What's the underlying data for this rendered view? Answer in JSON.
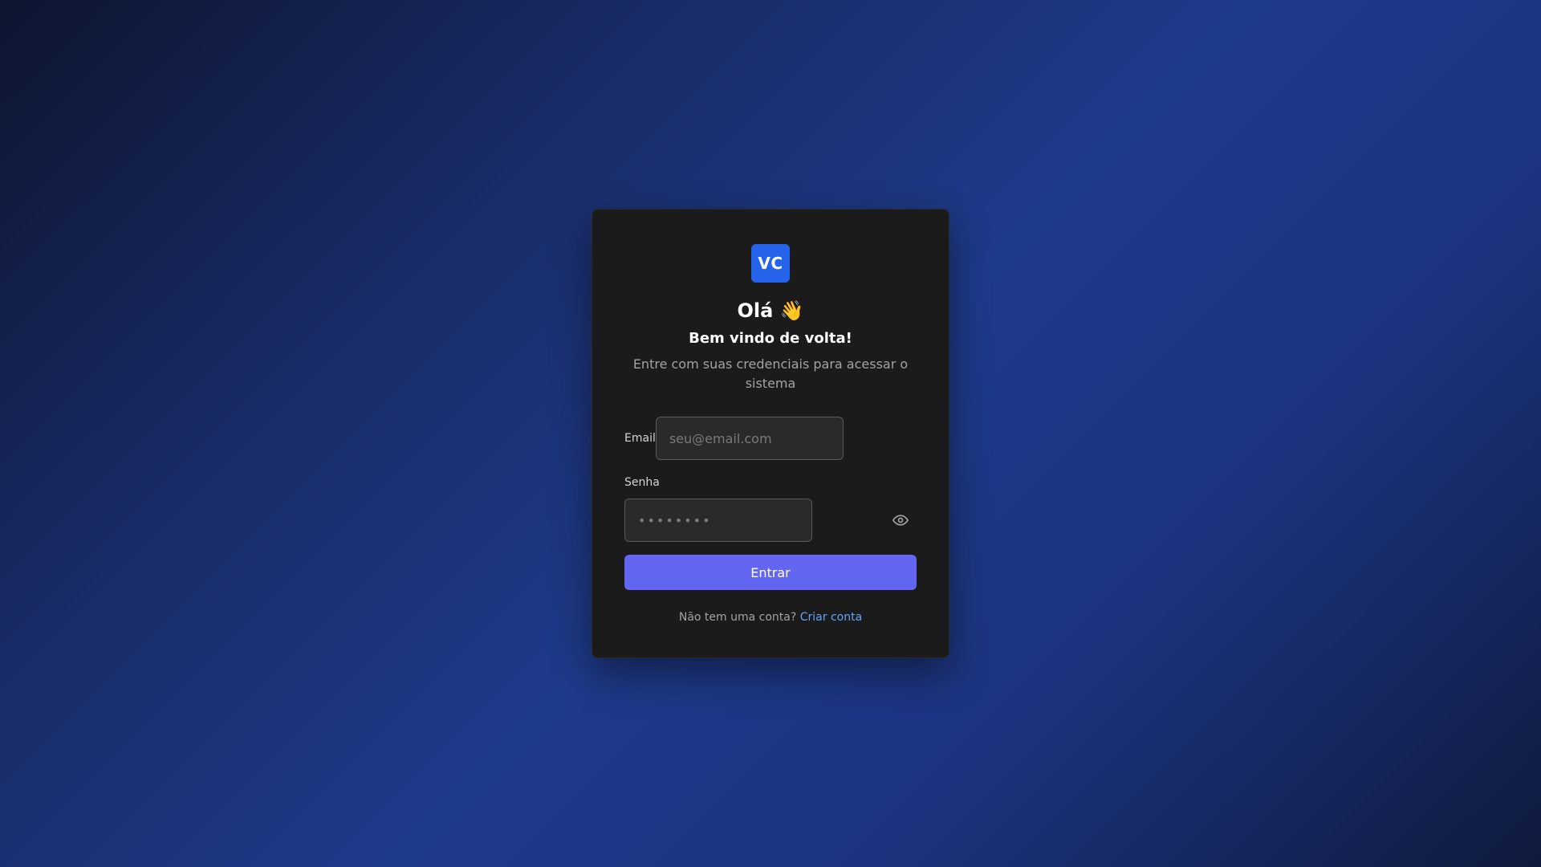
{
  "logo": {
    "text": "VC"
  },
  "heading": {
    "greeting": "Olá 👋",
    "welcome": "Bem vindo de volta!"
  },
  "subtitle": "Entre com suas credenciais para acessar o sistema",
  "form": {
    "email_label": "Email",
    "email_placeholder": "seu@email.com",
    "password_label": "Senha",
    "password_placeholder": "••••••••",
    "submit_label": "Entrar"
  },
  "footer": {
    "prompt": "Não tem uma conta?",
    "link_label": "Criar conta"
  },
  "colors": {
    "accent": "#6366f1",
    "logo_bg": "#2563eb",
    "link": "#60a5fa",
    "card_bg": "#1b1b1b"
  },
  "icons": {
    "password_toggle": "eye-icon"
  }
}
